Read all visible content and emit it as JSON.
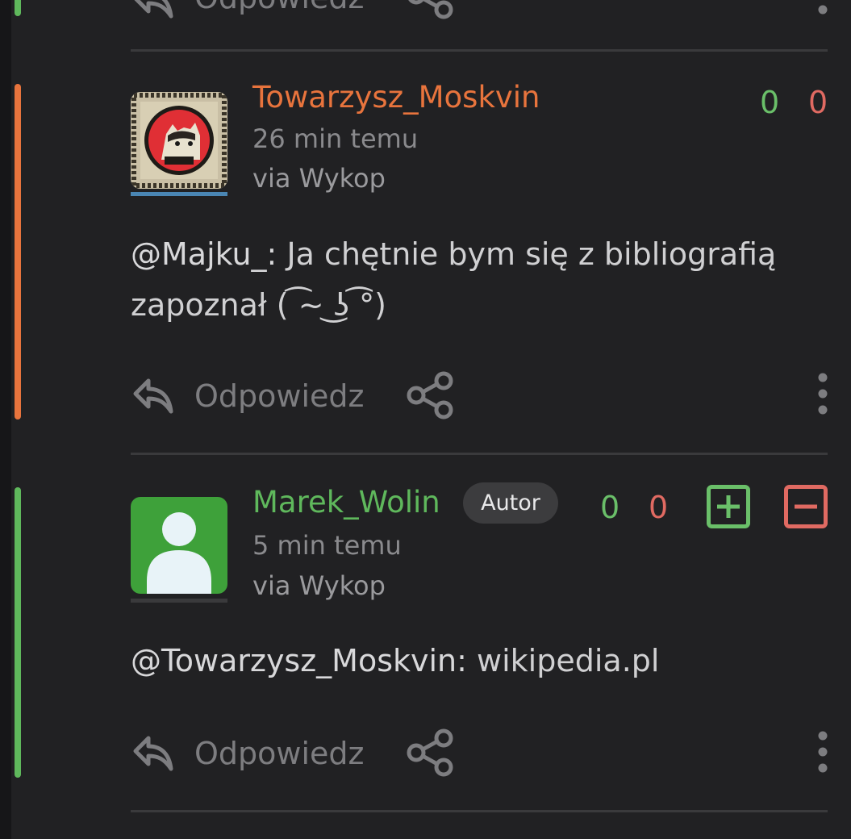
{
  "colors": {
    "background": "#212123",
    "op_accent": "#e8743d",
    "author_accent": "#5fb85c",
    "upvote": "#6abf69",
    "downvote": "#e06a62"
  },
  "top_partial": {
    "reply_label": "Odpowiedz"
  },
  "comments": [
    {
      "username": "Towarzysz_Moskvin",
      "time": "26 min temu",
      "via": "via Wykop",
      "votes_plus": "0",
      "votes_minus": "0",
      "mention": "@Majku_:",
      "text": " Ja chętnie bym się z bibliografią zapoznał ( ͡~ ͜ʖ ͡°)",
      "reply_label": "Odpowiedz",
      "avatar_icon": "cat-portrait-avatar",
      "thread_color": "#e8743d"
    },
    {
      "username": "Marek_Wolin",
      "badge": "Autor",
      "time": "5 min temu",
      "via": "via Wykop",
      "votes_plus": "0",
      "votes_minus": "0",
      "mention": "@Towarzysz_Moskvin:",
      "text": " wikipedia.pl",
      "reply_label": "Odpowiedz",
      "avatar_icon": "default-user-avatar",
      "thread_color": "#5fb85c"
    }
  ]
}
